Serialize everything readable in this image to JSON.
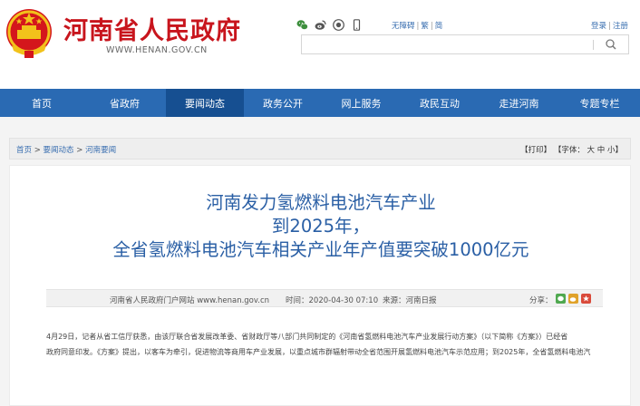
{
  "header": {
    "site_title": "河南省人民政府",
    "site_domain": "WWW.HENAN.GOV.CN",
    "top_links": [
      "无障碍",
      "繁",
      "简"
    ],
    "login": "登录",
    "register": "注册",
    "search": {
      "placeholder": ""
    }
  },
  "nav": {
    "items": [
      {
        "label": "首页"
      },
      {
        "label": "省政府"
      },
      {
        "label": "要闻动态"
      },
      {
        "label": "政务公开"
      },
      {
        "label": "网上服务"
      },
      {
        "label": "政民互动"
      },
      {
        "label": "走进河南"
      },
      {
        "label": "专题专栏"
      }
    ],
    "active_index": 2
  },
  "breadcrumb": {
    "items": [
      "首页",
      "要闻动态",
      "河南要闻"
    ],
    "separator": ">"
  },
  "page_tools": {
    "print": "【打印】",
    "font_label": "【字体：",
    "font_sizes": [
      "大",
      "中",
      "小"
    ],
    "font_close": "】"
  },
  "article": {
    "title_lines": [
      "河南发力氢燃料电池汽车产业",
      "到2025年，",
      "全省氢燃料电池汽车相关产业年产值要突破1000亿元"
    ],
    "source": "河南省人民政府门户网站 www.henan.gov.cn",
    "time": "时间：2020-04-30 07:10",
    "origin": "来源：河南日报",
    "share_label": "分享：",
    "body": [
      "4月29日，记者从省工信厅获悉，由该厅联合省发展改革委、省财政厅等八部门共同制定的《河南省氢燃料电池汽车产业发展行动方案》（以下简称《方案》）已经省",
      "政府同意印发。《方案》提出，以客车为牵引，促进物流等商用车产业发展，以重点城市群辐射带动全省范围开展氢燃料电池汽车示范应用；到2025年，全省氢燃料电池汽"
    ]
  },
  "colors": {
    "brand_red": "#c8151d",
    "nav_blue": "#2a6ab3",
    "nav_active": "#164f91",
    "title_blue": "#2a5fa5"
  }
}
